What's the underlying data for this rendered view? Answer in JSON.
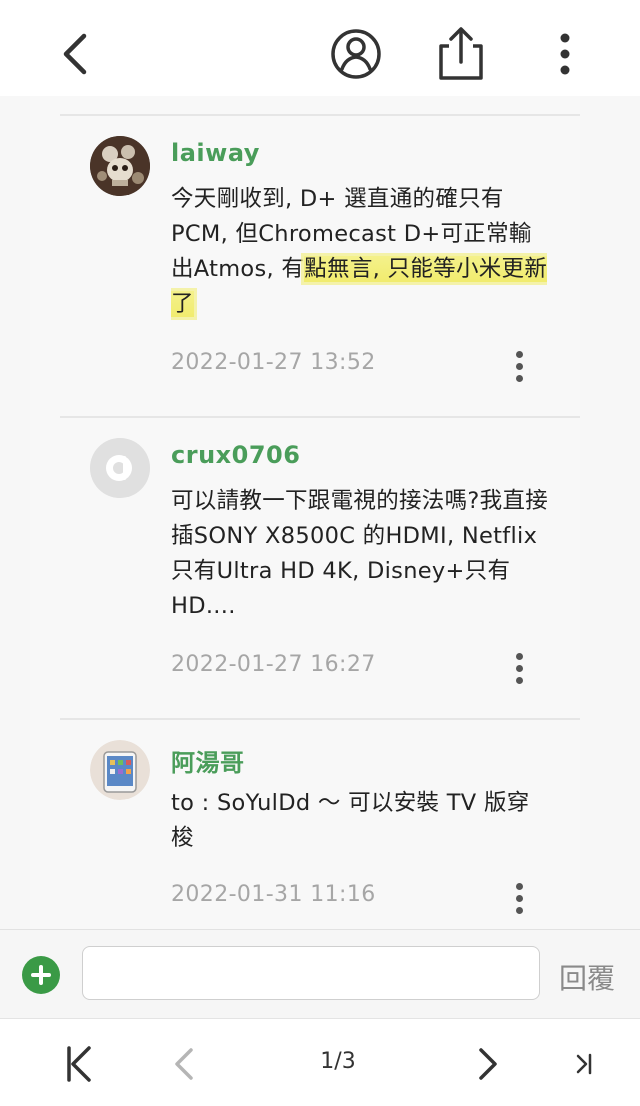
{
  "toolbar": {
    "back_icon": "chevron-left-icon",
    "profile_icon": "user-circle-icon",
    "share_icon": "share-icon",
    "more_icon": "more-vertical-icon"
  },
  "comments": [
    {
      "username": "laiway",
      "text_plain": "今天剛收到, D+ 選直通的確只有PCM, 但Chromecast D+可正常輸出Atmos, 有",
      "text_highlight": "點無言, 只能等小米更新了",
      "timestamp": "2022-01-27 13:52"
    },
    {
      "username": "crux0706",
      "text": "可以請教一下跟電視的接法嗎?我直接插SONY X8500C 的HDMI, Netflix 只有Ultra HD 4K, Disney+只有HD....",
      "timestamp": "2022-01-27 16:27"
    },
    {
      "username": "阿湯哥",
      "text": "to : SoYulDd ～ 可以安裝 TV 版穿梭",
      "timestamp": "2022-01-31 11:16"
    }
  ],
  "reply": {
    "placeholder": "",
    "button_label": "回覆"
  },
  "pagination": {
    "current": "1/3"
  },
  "colors": {
    "username": "#4a9d5a",
    "accent_green": "#3a9a46",
    "highlight": "#f2ee76"
  }
}
